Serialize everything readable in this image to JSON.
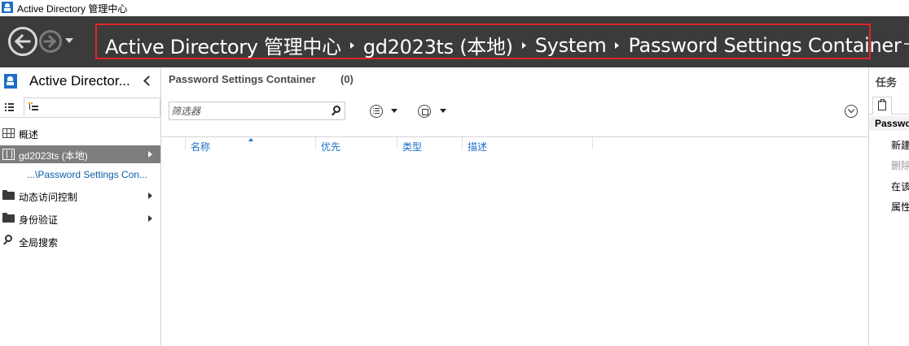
{
  "window": {
    "title": "Active Directory 管理中心"
  },
  "breadcrumb": [
    "Active Directory 管理中心",
    "gd2023ts (本地)",
    "System",
    "Password Settings Container"
  ],
  "left_panel": {
    "title": "Active Director...",
    "items": [
      {
        "label": "概述"
      },
      {
        "label": "gd2023ts (本地)"
      },
      {
        "label": "...\\Password Settings Con..."
      },
      {
        "label": "动态访问控制"
      },
      {
        "label": "身份验证"
      },
      {
        "label": "全局搜索"
      }
    ]
  },
  "main": {
    "title": "Password Settings Container",
    "count": "(0)",
    "filter_placeholder": "筛选器",
    "columns": [
      "名称",
      "优先",
      "类型",
      "描述"
    ]
  },
  "right_panel": {
    "title": "任务",
    "section": "Password Settings Container",
    "tasks": [
      "新建",
      "删除",
      "在该容器中搜索",
      "属性"
    ]
  },
  "colors": {
    "navbar": "#3b3b3b",
    "breadcrumb_border": "#e0242c",
    "selected_item": "#7d7d7d",
    "link": "#1e6fc5"
  }
}
